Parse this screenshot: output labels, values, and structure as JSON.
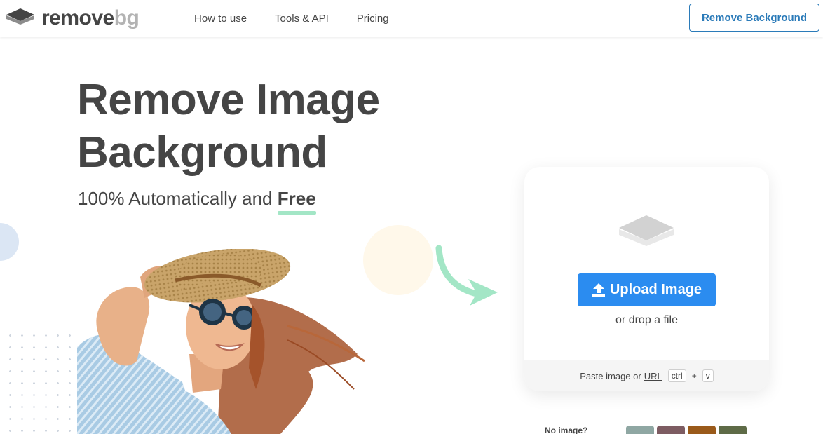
{
  "header": {
    "logo": {
      "word_a": "remove",
      "word_b": "bg",
      "icon": "layers-icon"
    },
    "nav": [
      "How to use",
      "Tools & API",
      "Pricing"
    ],
    "cta_label": "Remove Background"
  },
  "hero": {
    "title_line1": "Remove Image",
    "title_line2": "Background",
    "subtitle_prefix": "100% Automatically and ",
    "subtitle_highlight": "Free"
  },
  "upload": {
    "icon": "layers-icon",
    "button_label": "Upload Image",
    "button_icon": "upload-icon",
    "drop_text": "or drop a file",
    "paste_text": "Paste image or ",
    "url_label": "URL",
    "key_ctrl": "ctrl",
    "key_plus": "+",
    "key_v": "v"
  },
  "samples": {
    "label": "No image?"
  },
  "colors": {
    "accent": "#2b8cf0",
    "cta": "#2b7bb9",
    "highlight": "#a3e6c6",
    "text": "#454545"
  }
}
